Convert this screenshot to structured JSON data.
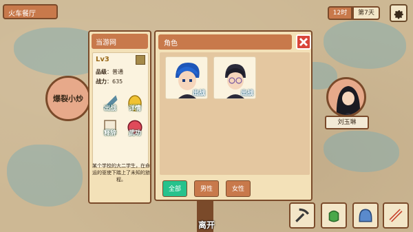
{
  "hud": {
    "location": "火车餐厅",
    "time": "12时",
    "day": "第7天"
  },
  "map": {
    "badge": "爆裂小炒"
  },
  "profile": {
    "title": "当游网",
    "level": "Lv3",
    "grade_label": "品级",
    "grade_value": "普通",
    "power_label": "战力",
    "power_value": "635",
    "actions": {
      "deploy": "出战",
      "details": "详情",
      "release": "释辞",
      "train": "武功"
    },
    "description": "某个学校的大二学生，在命运的驱使下踏上了未知的旅程。"
  },
  "roles": {
    "title": "角色",
    "cards": [
      {
        "status": "出战"
      },
      {
        "status": "出战"
      }
    ],
    "filters": {
      "all": "全部",
      "male": "男性",
      "female": "女性"
    }
  },
  "npc": {
    "name": "刘玉琳"
  },
  "leave": "离开",
  "colors": {
    "accent": "#c8794b",
    "panel": "#f3e1b8",
    "close": "#d9453a",
    "active_filter": "#27c28c",
    "filter": "#c8794b"
  }
}
